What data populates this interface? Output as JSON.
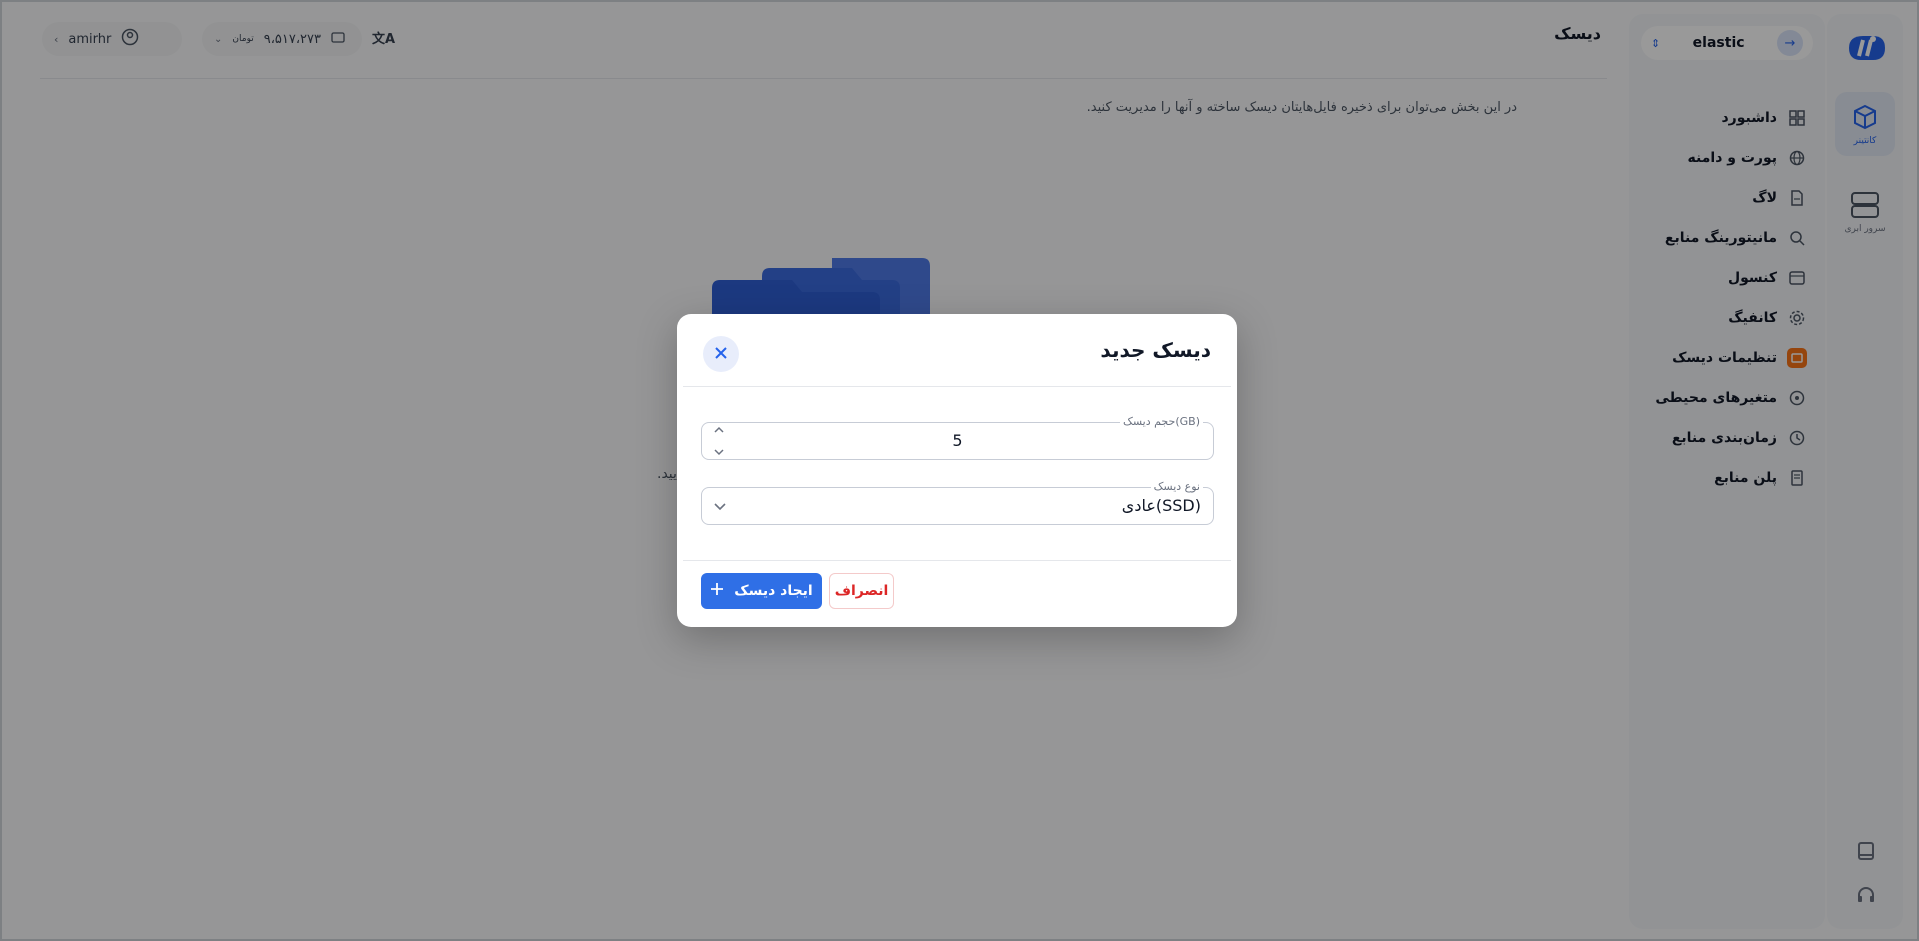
{
  "page": {
    "title": "دیسک",
    "description": "در این بخش می‌توان برای ذخیره فایل‌هایتان دیسک ساخته و آنها را مدیریت کنید.",
    "partial_bg_text": "ایید."
  },
  "topbar": {
    "username": "amirhr",
    "balance": "۹،۵۱۷،۲۷۳",
    "balance_unit": "تومان",
    "translate_label": "文A"
  },
  "rail": {
    "items": [
      {
        "label": "کانتینر",
        "icon": "container-icon",
        "active": true
      },
      {
        "label": "سرور ابری",
        "icon": "server-icon",
        "active": false
      }
    ],
    "bottom_icons": [
      "book-icon",
      "headset-icon"
    ]
  },
  "sidebar": {
    "service_name": "elastic",
    "menu": [
      {
        "label": "داشبورد",
        "icon": "dashboard-icon",
        "active": false
      },
      {
        "label": "پورت و دامنه",
        "icon": "globe-icon",
        "active": false
      },
      {
        "label": "لاگ",
        "icon": "file-icon",
        "active": false
      },
      {
        "label": "مانیتورینگ منابع",
        "icon": "monitor-icon",
        "active": false
      },
      {
        "label": "کنسول",
        "icon": "console-icon",
        "active": false
      },
      {
        "label": "کانفیگ",
        "icon": "gear-icon",
        "active": false
      },
      {
        "label": "تنظیمات دیسک",
        "icon": "disk-icon",
        "active": true
      },
      {
        "label": "متغیرهای محیطی",
        "icon": "variable-icon",
        "active": false
      },
      {
        "label": "زمان‌بندی منابع",
        "icon": "clock-icon",
        "active": false
      },
      {
        "label": "پلن منابع",
        "icon": "plan-icon",
        "active": false
      }
    ]
  },
  "modal": {
    "title": "دیسک جدید",
    "size_label": "حجم دیسک(GB)",
    "size_value": "5",
    "type_label": "نوع دیسک",
    "type_value": "عادی(SSD)",
    "create_label": "ایجاد دیسک",
    "cancel_label": "انصراف"
  },
  "colors": {
    "primary": "#2f6fe6",
    "danger": "#dc2626",
    "active_menu": "#f97316"
  }
}
